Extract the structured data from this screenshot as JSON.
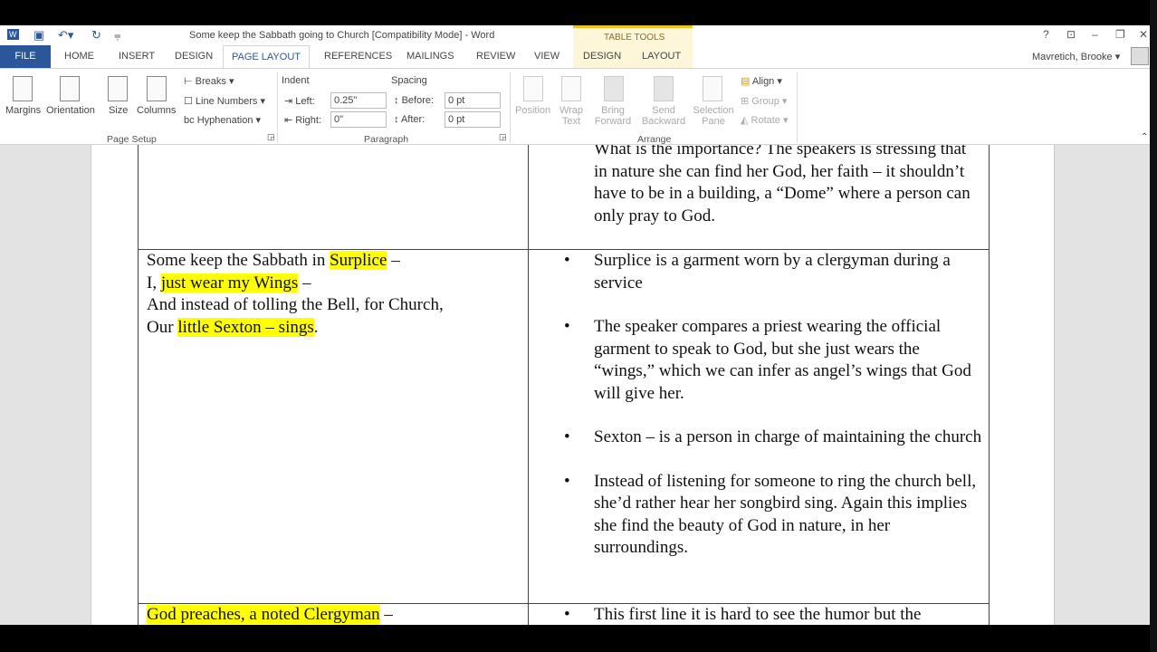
{
  "window": {
    "title": "Some keep the Sabbath going to Church [Compatibility Mode] - Word",
    "context_tab_group": "TABLE TOOLS",
    "user": "Mavretich, Brooke",
    "help": "?"
  },
  "tabs": [
    "FILE",
    "HOME",
    "INSERT",
    "DESIGN",
    "PAGE LAYOUT",
    "REFERENCES",
    "MAILINGS",
    "REVIEW",
    "VIEW",
    "DESIGN",
    "LAYOUT"
  ],
  "ribbon": {
    "page_setup": {
      "margins": "Margins",
      "orientation": "Orientation",
      "size": "Size",
      "columns": "Columns",
      "breaks": "Breaks",
      "line_numbers": "Line Numbers",
      "hyphenation": "Hyphenation",
      "group": "Page Setup"
    },
    "paragraph": {
      "indent": "Indent",
      "left_label": "Left:",
      "left_value": "0.25\"",
      "right_label": "Right:",
      "right_value": "0\"",
      "spacing": "Spacing",
      "before_label": "Before:",
      "before_value": "0 pt",
      "after_label": "After:",
      "after_value": "0 pt",
      "group": "Paragraph"
    },
    "arrange": {
      "position": "Position",
      "wrap_text": "Wrap Text",
      "bring_forward": "Bring Forward",
      "send_backward": "Send Backward",
      "selection_pane": "Selection Pane",
      "align": "Align",
      "group_btn": "Group",
      "rotate": "Rotate",
      "group": "Arrange"
    }
  },
  "document": {
    "row1_right": "What is the importance? The speakers is stressing that in nature she can find her God, her faith – it shouldn’t have to be in a building, a “Dome” where a person can only pray to God.",
    "row2_left": [
      [
        {
          "t": "Some keep the Sabbath in "
        },
        {
          "t": "Surplice",
          "hl": true
        },
        {
          "t": " –"
        }
      ],
      [
        {
          "t": "I, "
        },
        {
          "t": "just wear my Wings",
          "hl": true
        },
        {
          "t": " –"
        }
      ],
      [
        {
          "t": "And instead of tolling the Bell, for Church,"
        }
      ],
      [
        {
          "t": "Our "
        },
        {
          "t": "little Sexton – sings",
          "hl": true
        },
        {
          "t": "."
        }
      ]
    ],
    "row2_right": [
      "Surplice is a garment worn by a clergyman during a service",
      "The speaker compares a priest wearing the official garment to speak to God, but she just wears the “wings,” which we can infer as angel’s wings that God will give her.",
      "Sexton – is a person in charge of maintaining the church",
      "Instead of listening for someone to ring the church bell, she’d rather hear her songbird sing. Again this implies she find the beauty of God in nature, in her surroundings."
    ],
    "row3_left": [
      {
        "t": "God preaches, a noted Clergyman",
        "hl": true
      },
      {
        "t": " –"
      }
    ],
    "row3_right": "This first line it is hard to see the humor but the"
  }
}
